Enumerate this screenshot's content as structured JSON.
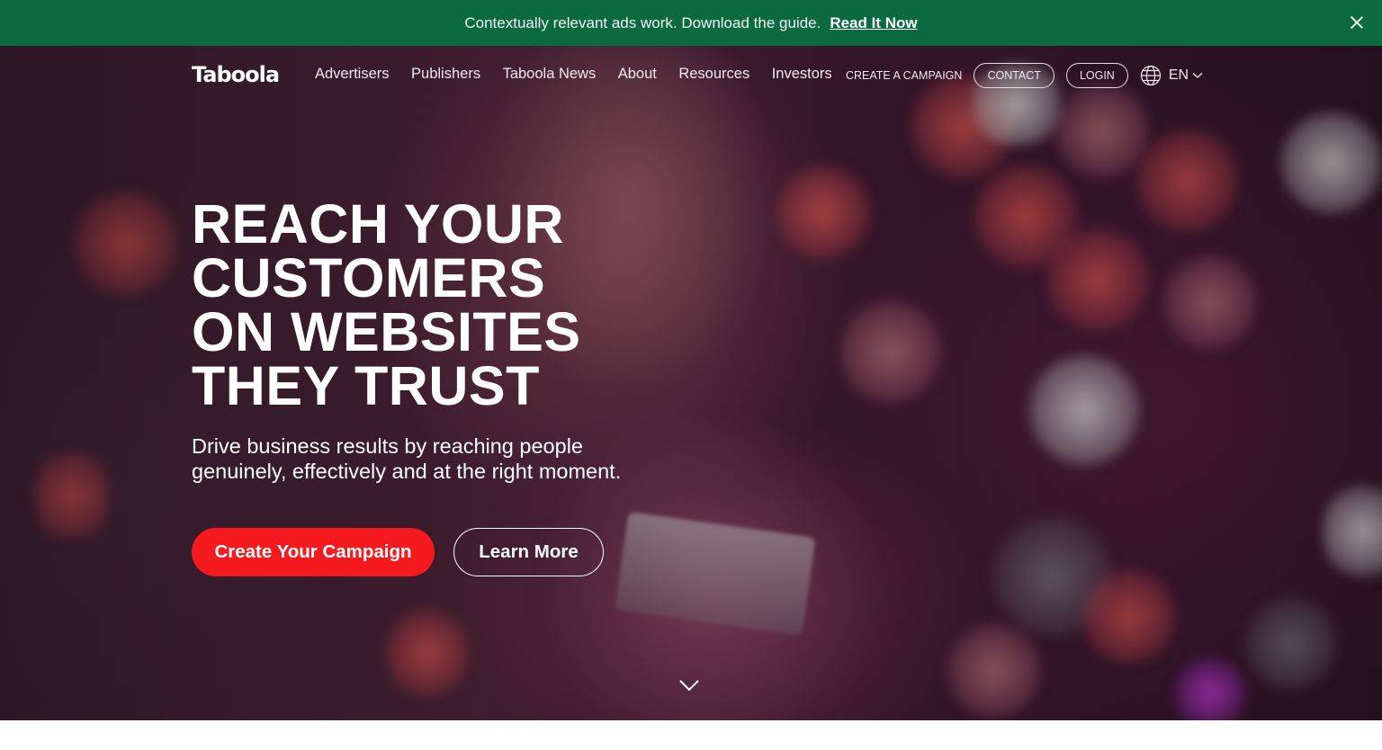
{
  "banner": {
    "text": "Contextually relevant ads work. Download the guide.",
    "link_label": "Read It Now"
  },
  "nav": {
    "logo": "Taboola",
    "links": [
      "Advertisers",
      "Publishers",
      "Taboola News",
      "About",
      "Resources",
      "Investors"
    ],
    "create_campaign": "CREATE A CAMPAIGN",
    "contact": "CONTACT",
    "login": "LOGIN",
    "language": "EN"
  },
  "hero": {
    "headline_lines": [
      "REACH YOUR",
      "CUSTOMERS",
      "ON WEBSITES",
      "THEY TRUST"
    ],
    "subtext": "Drive business results by reaching people genuinely, effectively and at the right moment.",
    "primary_cta": "Create Your Campaign",
    "secondary_cta": "Learn More"
  },
  "colors": {
    "banner_bg": "#0b6a3f",
    "cta_red": "#f51a1f"
  },
  "icons": {
    "close": "close-icon",
    "globe": "globe-icon",
    "language_dropdown": "chevron-down-icon",
    "scroll": "chevron-down-icon"
  }
}
